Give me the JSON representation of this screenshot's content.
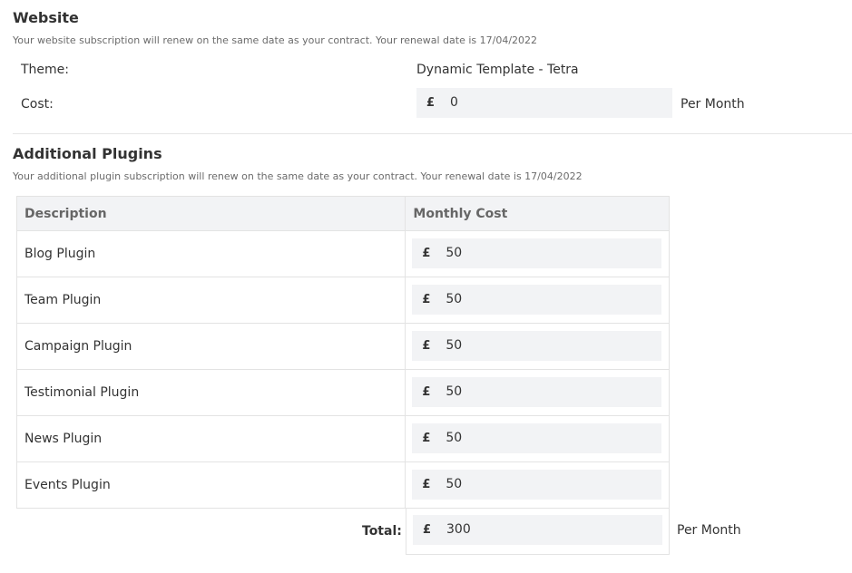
{
  "website": {
    "heading": "Website",
    "subtitle": "Your website subscription will renew on the same date as your contract. Your renewal date is 17/04/2022",
    "theme_label": "Theme:",
    "theme_value": "Dynamic Template - Tetra",
    "cost_label": "Cost:",
    "currency": "£",
    "cost_value": "0",
    "cost_period": "Per Month"
  },
  "plugins": {
    "heading": "Additional Plugins",
    "subtitle": "Your additional plugin subscription will renew on the same date as your contract. Your renewal date is 17/04/2022",
    "columns": [
      "Description",
      "Monthly Cost"
    ],
    "currency": "£",
    "rows": [
      {
        "description": "Blog Plugin",
        "cost": "50"
      },
      {
        "description": "Team Plugin",
        "cost": "50"
      },
      {
        "description": "Campaign Plugin",
        "cost": "50"
      },
      {
        "description": "Testimonial Plugin",
        "cost": "50"
      },
      {
        "description": "News Plugin",
        "cost": "50"
      },
      {
        "description": "Events Plugin",
        "cost": "50"
      }
    ],
    "total_label": "Total:",
    "total_value": "300",
    "total_period": "Per Month"
  }
}
